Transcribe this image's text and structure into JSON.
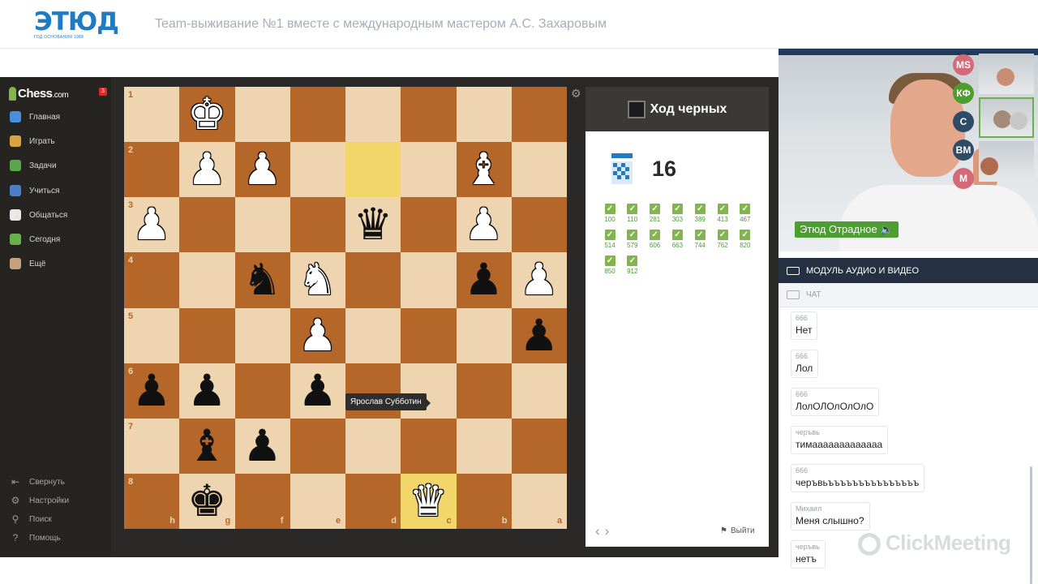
{
  "header": {
    "logo_text": "ЭТЮД",
    "logo_subtitle": "ГОД ОСНОВАНИЯ 1988",
    "title": "Team-выживание №1 вместе с международным мастером А.С. Захаровым"
  },
  "chess_site": {
    "brand": "Chess",
    "brand_suffix": ".com",
    "badge": "3",
    "nav": [
      {
        "label": "Главная",
        "icon": "home-icon",
        "color": "#4a8fd9"
      },
      {
        "label": "Играть",
        "icon": "play-icon",
        "color": "#d9a441"
      },
      {
        "label": "Задачи",
        "icon": "puzzle-icon",
        "color": "#5aa64a"
      },
      {
        "label": "Учиться",
        "icon": "learn-icon",
        "color": "#4d7fc8"
      },
      {
        "label": "Общаться",
        "icon": "social-icon",
        "color": "#e8e8e8"
      },
      {
        "label": "Сегодня",
        "icon": "today-icon",
        "color": "#6ab04c"
      },
      {
        "label": "Ещё",
        "icon": "more-icon",
        "color": "#c7a27c"
      }
    ],
    "bottom_nav": [
      {
        "label": "Свернуть",
        "icon": "collapse-icon",
        "glyph": "⇤"
      },
      {
        "label": "Настройки",
        "icon": "settings-icon",
        "glyph": "⚙"
      },
      {
        "label": "Поиск",
        "icon": "search-icon",
        "glyph": "⚲"
      },
      {
        "label": "Помощь",
        "icon": "help-icon",
        "glyph": "?"
      }
    ]
  },
  "board": {
    "ranks": [
      "1",
      "2",
      "3",
      "4",
      "5",
      "6",
      "7",
      "8"
    ],
    "files": [
      "h",
      "g",
      "f",
      "e",
      "d",
      "c",
      "b",
      "a"
    ],
    "highlight": [
      "d2",
      "c8"
    ],
    "pieces": [
      {
        "sq": "g1",
        "type": "king",
        "color": "white"
      },
      {
        "sq": "g2",
        "type": "pawn",
        "color": "white"
      },
      {
        "sq": "f2",
        "type": "pawn",
        "color": "white"
      },
      {
        "sq": "b2",
        "type": "bishop",
        "color": "white"
      },
      {
        "sq": "h3",
        "type": "pawn",
        "color": "white"
      },
      {
        "sq": "d3",
        "type": "queen",
        "color": "black"
      },
      {
        "sq": "b3",
        "type": "pawn",
        "color": "white"
      },
      {
        "sq": "f4",
        "type": "knight",
        "color": "black"
      },
      {
        "sq": "e4",
        "type": "knight",
        "color": "white"
      },
      {
        "sq": "b4",
        "type": "pawn",
        "color": "black"
      },
      {
        "sq": "a4",
        "type": "pawn",
        "color": "white"
      },
      {
        "sq": "e5",
        "type": "pawn",
        "color": "white"
      },
      {
        "sq": "a5",
        "type": "pawn",
        "color": "black"
      },
      {
        "sq": "h6",
        "type": "pawn",
        "color": "black"
      },
      {
        "sq": "g6",
        "type": "pawn",
        "color": "black"
      },
      {
        "sq": "e6",
        "type": "pawn",
        "color": "black"
      },
      {
        "sq": "g7",
        "type": "bishop",
        "color": "black"
      },
      {
        "sq": "f7",
        "type": "pawn",
        "color": "black"
      },
      {
        "sq": "g8",
        "type": "king",
        "color": "black"
      },
      {
        "sq": "c8",
        "type": "queen",
        "color": "white"
      }
    ],
    "tooltip": "Ярослав Субботин"
  },
  "puzzle_panel": {
    "turn_label": "Ход черных",
    "rating": "16",
    "solved": [
      "100",
      "110",
      "281",
      "303",
      "389",
      "413",
      "467",
      "514",
      "579",
      "606",
      "663",
      "744",
      "762",
      "820",
      "850",
      "912"
    ],
    "exit_label": "Выйти"
  },
  "video": {
    "presenter_label": "Этюд Отрадное",
    "participants": [
      {
        "initials": "MS",
        "color": "#d46a78"
      },
      {
        "initials": "КФ",
        "color": "#4b9e2f"
      },
      {
        "initials": "С",
        "color": "#2e4b68"
      },
      {
        "initials": "ВМ",
        "color": "#2e4b68"
      },
      {
        "initials": "М",
        "color": "#d46a78"
      }
    ]
  },
  "av_module_label": "МОДУЛЬ АУДИО И ВИДЕО",
  "chat": {
    "header": "ЧАТ",
    "messages": [
      {
        "author": "666",
        "text": "Нет"
      },
      {
        "author": "666",
        "text": "Лол"
      },
      {
        "author": "666",
        "text": "ЛолОЛОлОлОлО"
      },
      {
        "author": "черъвь",
        "text": "тимааааааааааааа"
      },
      {
        "author": "666",
        "text": "черъвьъъъъъъъъъъъъъъъ"
      },
      {
        "author": "Михаил",
        "text": "Меня слышно?"
      },
      {
        "author": "черъвь",
        "text": "нетъ"
      }
    ],
    "watermark": "ClickMeeting"
  }
}
